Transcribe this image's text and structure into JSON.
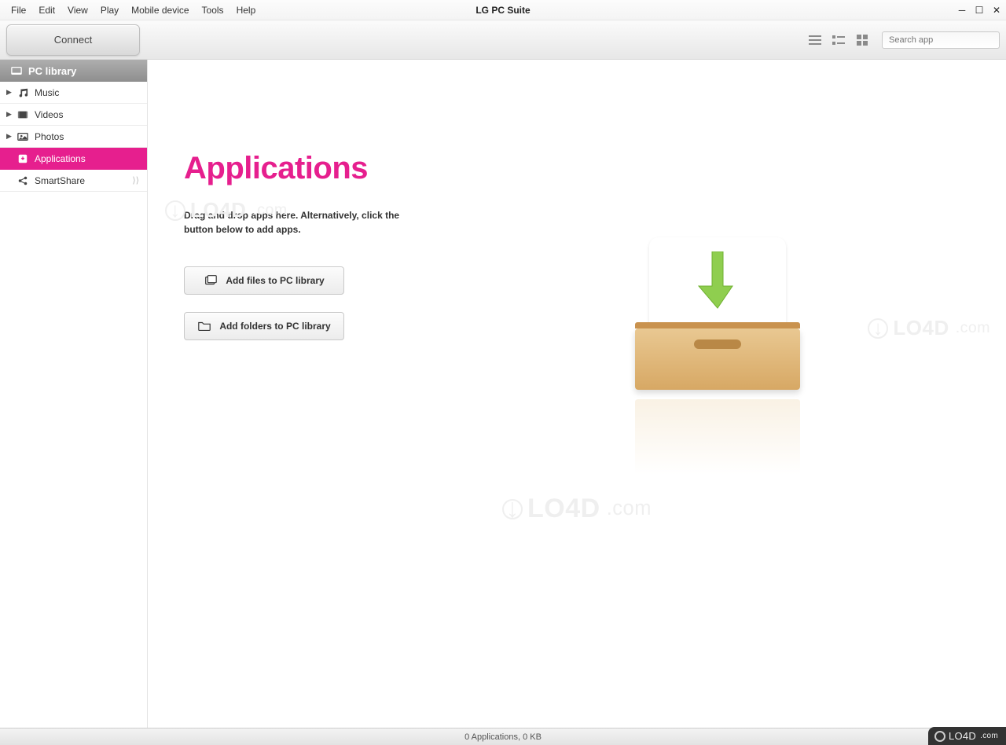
{
  "window": {
    "title": "LG PC Suite"
  },
  "menu": {
    "items": [
      "File",
      "Edit",
      "View",
      "Play",
      "Mobile device",
      "Tools",
      "Help"
    ]
  },
  "toolbar": {
    "connect": "Connect",
    "search_placeholder": "Search app"
  },
  "sidebar": {
    "header": "PC library",
    "items": [
      {
        "label": "Music",
        "icon": "music-icon",
        "expandable": true,
        "active": false
      },
      {
        "label": "Videos",
        "icon": "video-icon",
        "expandable": true,
        "active": false
      },
      {
        "label": "Photos",
        "icon": "photo-icon",
        "expandable": true,
        "active": false
      },
      {
        "label": "Applications",
        "icon": "app-icon",
        "expandable": false,
        "active": true
      },
      {
        "label": "SmartShare",
        "icon": "share-icon",
        "expandable": false,
        "active": false,
        "broadcast": true
      }
    ]
  },
  "main": {
    "title": "Applications",
    "description": "Drag and drop apps here. Alternatively, click the button below to add apps.",
    "add_files": "Add files to PC library",
    "add_folders": "Add folders to PC library"
  },
  "status": {
    "text": "0 Applications, 0 KB"
  },
  "watermark": {
    "brand": "LO4D",
    "suffix": ".com"
  },
  "colors": {
    "accent": "#e61f8e"
  }
}
